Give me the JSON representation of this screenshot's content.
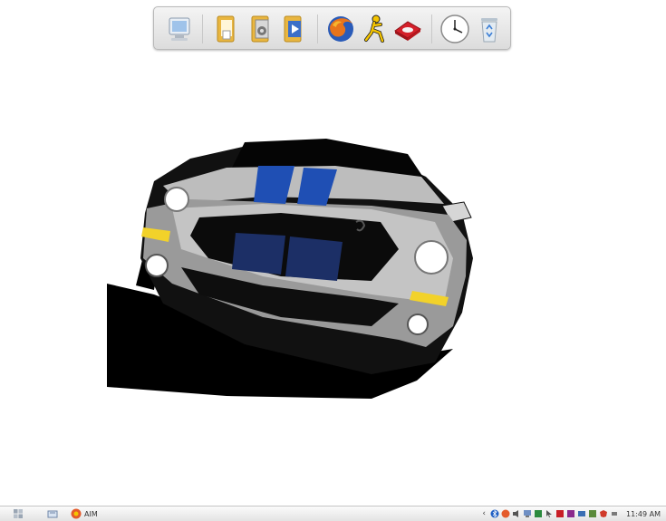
{
  "dock": {
    "icons": [
      {
        "name": "my-computer-icon"
      },
      {
        "name": "documents-folder-icon"
      },
      {
        "name": "music-folder-icon"
      },
      {
        "name": "videos-folder-icon"
      },
      {
        "name": "firefox-icon"
      },
      {
        "name": "aim-icon"
      },
      {
        "name": "burn-disc-icon"
      },
      {
        "name": "clock-icon"
      },
      {
        "name": "recycle-bin-icon"
      }
    ]
  },
  "taskbar": {
    "task": {
      "label": "AIM"
    },
    "tray": {
      "chevron": "‹",
      "clock": "11:49 AM"
    }
  },
  "colors": {
    "car_body": "#bfbfbf",
    "stripe": "#1f4fb4",
    "background": "#ffffff"
  }
}
